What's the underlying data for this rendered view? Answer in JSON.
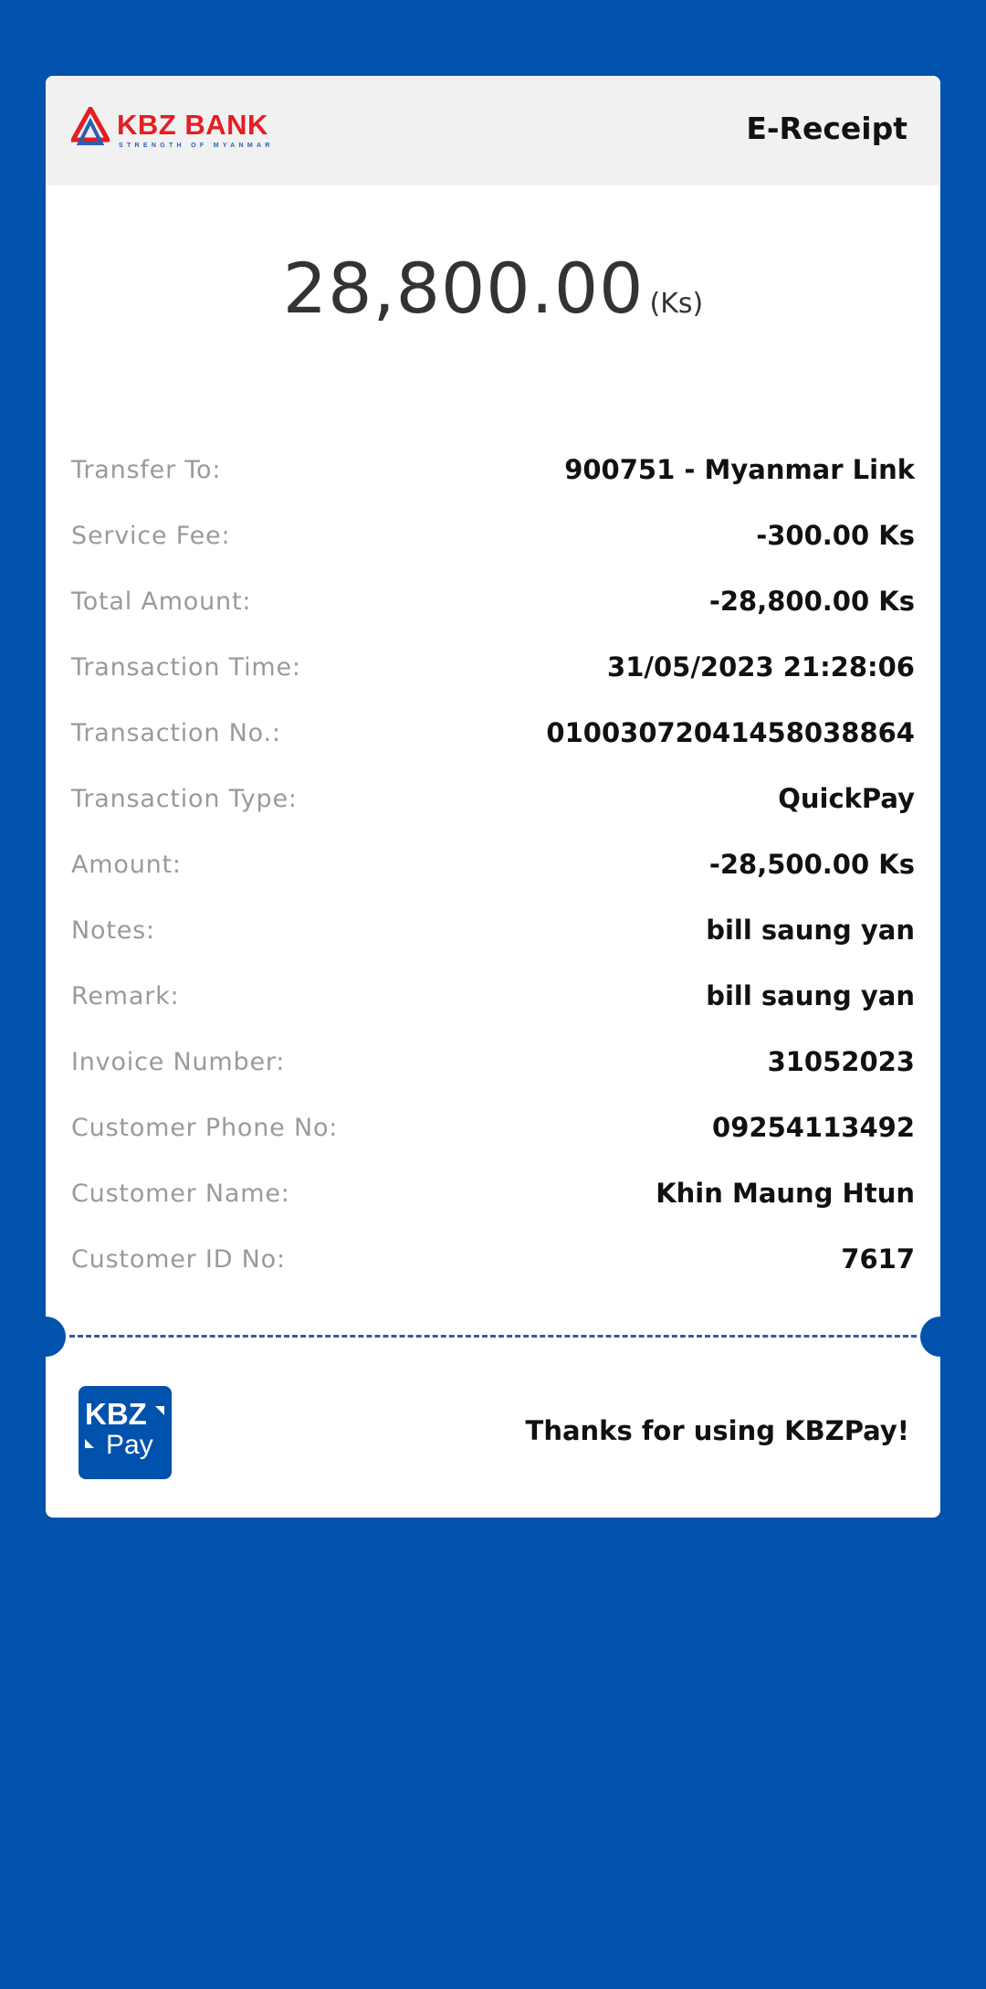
{
  "header": {
    "logo_text": "KBZ BANK",
    "logo_tagline": "STRENGTH OF MYANMAR",
    "title": "E-Receipt"
  },
  "amount": {
    "value": "28,800.00",
    "currency": "(Ks)"
  },
  "details": [
    {
      "label": "Transfer To:",
      "value": "900751 - Myanmar Link"
    },
    {
      "label": "Service Fee:",
      "value": "-300.00 Ks"
    },
    {
      "label": "Total Amount:",
      "value": "-28,800.00 Ks"
    },
    {
      "label": "Transaction Time:",
      "value": "31/05/2023 21:28:06"
    },
    {
      "label": "Transaction No.:",
      "value": "01003072041458038864"
    },
    {
      "label": "Transaction Type:",
      "value": "QuickPay"
    },
    {
      "label": "Amount:",
      "value": "-28,500.00 Ks"
    },
    {
      "label": "Notes:",
      "value": "bill saung yan"
    },
    {
      "label": "Remark:",
      "value": "bill saung yan"
    },
    {
      "label": "Invoice Number:",
      "value": "31052023"
    },
    {
      "label": "Customer Phone No:",
      "value": "09254113492"
    },
    {
      "label": "Customer Name:",
      "value": "Khin Maung Htun"
    },
    {
      "label": "Customer ID No:",
      "value": "7617"
    }
  ],
  "footer": {
    "kbzpay_top": "KBZ",
    "kbzpay_bottom": "Pay",
    "thanks": "Thanks for using KBZPay!"
  },
  "colors": {
    "background": "#0052ad",
    "card": "#ffffff",
    "header_bg": "#f1f1f1",
    "brand_red": "#e31e24",
    "brand_blue": "#2b5fb3",
    "label_gray": "#9a9a9a"
  }
}
